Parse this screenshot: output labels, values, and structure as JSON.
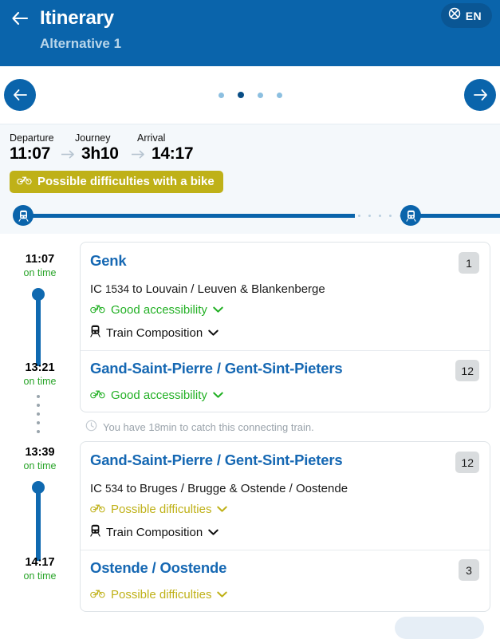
{
  "header": {
    "back_icon": "arrow-left-icon",
    "title": "Itinerary",
    "subtitle": "Alternative 1",
    "language": {
      "icon": "globe-icon",
      "code": "EN"
    }
  },
  "carousel": {
    "prev_icon": "arrow-left-icon",
    "next_icon": "arrow-right-icon",
    "dot_count": 4,
    "active_index": 1
  },
  "summary": {
    "departure_label": "Departure",
    "journey_label": "Journey",
    "arrival_label": "Arrival",
    "departure_time": "11:07",
    "journey_duration": "3h10",
    "arrival_time": "14:17",
    "bike_badge": {
      "icon": "bicycle-icon",
      "text": "Possible difficulties with a bike",
      "color": "#bfb118"
    },
    "progress": {
      "start_icon": "train-icon",
      "transfer_icon": "train-icon",
      "line_color": "#0a64ab",
      "dot_color": "#b9cfe0"
    }
  },
  "timeline": [
    {
      "time": "11:07",
      "status": "on time"
    },
    {
      "time": "13:21",
      "status": "on time"
    },
    {
      "time": "13:39",
      "status": "on time"
    },
    {
      "time": "14:17",
      "status": "on time"
    }
  ],
  "legs": [
    {
      "origin": {
        "station": "Genk",
        "platform": "1",
        "train_code": "IC",
        "train_number": "1534",
        "to_label": "to",
        "destination": "Louvain / Leuven & Blankenberge",
        "accessibility": {
          "icon": "bicycle-icon",
          "text": "Good accessibility",
          "level": "good",
          "chevron": "chevron-down-icon"
        },
        "composition": {
          "icon": "train-icon",
          "text": "Train Composition",
          "chevron": "chevron-down-icon"
        }
      },
      "arrival": {
        "station": "Gand-Saint-Pierre / Gent-Sint-Pieters",
        "platform": "12",
        "accessibility": {
          "icon": "bicycle-icon",
          "text": "Good accessibility",
          "level": "good",
          "chevron": "chevron-down-icon"
        }
      }
    },
    {
      "origin": {
        "station": "Gand-Saint-Pierre / Gent-Sint-Pieters",
        "platform": "12",
        "train_code": "IC",
        "train_number": "534",
        "to_label": "to",
        "destination": "Bruges / Brugge & Ostende / Oostende",
        "accessibility": {
          "icon": "bicycle-icon",
          "text": "Possible difficulties",
          "level": "warn",
          "chevron": "chevron-down-icon"
        },
        "composition": {
          "icon": "train-icon",
          "text": "Train Composition",
          "chevron": "chevron-down-icon"
        }
      },
      "arrival": {
        "station": "Ostende / Oostende",
        "platform": "3",
        "accessibility": {
          "icon": "bicycle-icon",
          "text": "Possible difficulties",
          "level": "warn",
          "chevron": "chevron-down-icon"
        }
      }
    }
  ],
  "connection_note": {
    "icon": "clock-icon",
    "text": "You have 18min to catch this connecting train."
  },
  "colors": {
    "brand_blue": "#0a64ab",
    "link_blue": "#1668b3",
    "accent_green": "#22b024",
    "accent_yellow": "#bfb118",
    "summary_bg": "#f4f8fb"
  }
}
